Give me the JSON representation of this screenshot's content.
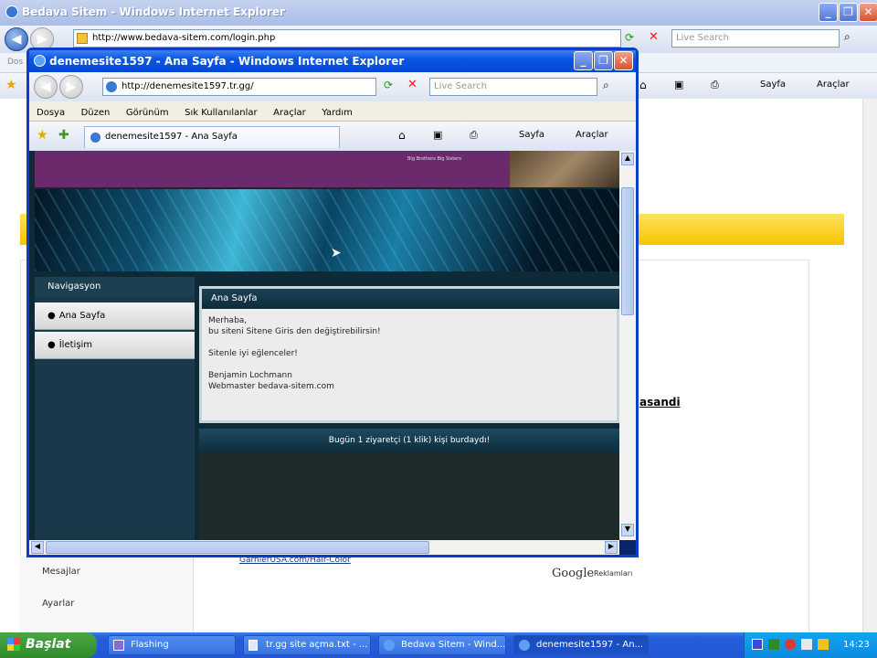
{
  "back_window": {
    "title": "Bedava Sitem - Windows Internet Explorer",
    "address": "http://www.bedava-sitem.com/login.php",
    "search_placeholder": "Live Search",
    "menu_stub": "Dos",
    "toolbar": {
      "sayfa": "Sayfa",
      "araclar": "Araçlar"
    },
    "content_link": "asandi",
    "sidebar": [
      "Mesajlar",
      "Ayarlar"
    ],
    "ad_link": "GarnierUSA.com/Hair-Color",
    "google_ads": "Google",
    "google_ads_sub": "Reklamları"
  },
  "front_window": {
    "title": "denemesite1597 - Ana Sayfa - Windows Internet Explorer",
    "address": "http://denemesite1597.tr.gg/",
    "search_placeholder": "Live Search",
    "menu": [
      "Dosya",
      "Düzen",
      "Görünüm",
      "Sık Kullanılanlar",
      "Araçlar",
      "Yardım"
    ],
    "tab_title": "denemesite1597 - Ana Sayfa",
    "toolbar": {
      "sayfa": "Sayfa",
      "araclar": "Araçlar"
    }
  },
  "page": {
    "banner_small": "Big Brothers Big Sisters",
    "nav_heading": "Navigasyon",
    "nav_items": [
      "Ana Sayfa",
      "İletişim"
    ],
    "main_heading": "Ana Sayfa",
    "main_lines": [
      "Merhaba,",
      "bu siteni Sitene Giris den değiştirebilirsin!",
      "",
      "Sitenle iyi eğlenceler!",
      "",
      "Benjamin Lochmann",
      "Webmaster bedava-sitem.com"
    ],
    "counter": "Bugün 1 ziyaretçi (1 klik) kişi burdaydı!"
  },
  "taskbar": {
    "start": "Başlat",
    "tasks": [
      "Flashing",
      "tr.gg site açma.txt - ...",
      "Bedava Sitem - Wind...",
      "denemesite1597 - An..."
    ],
    "clock": "14:23"
  }
}
